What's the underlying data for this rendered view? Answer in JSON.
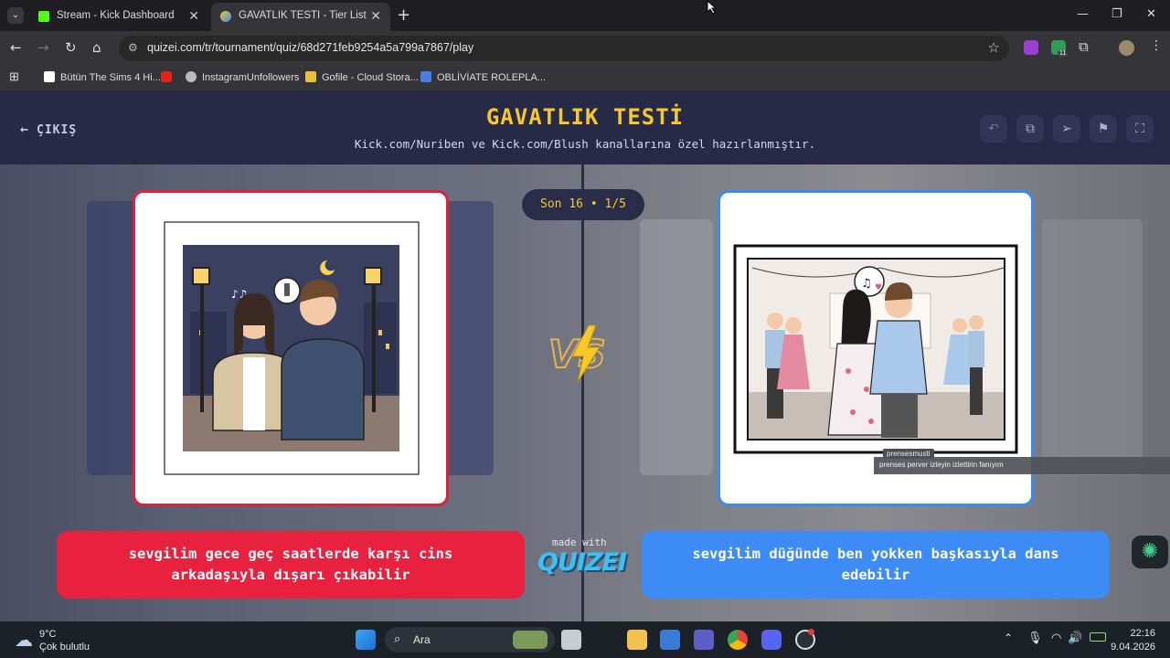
{
  "browser": {
    "tabs": [
      {
        "title": "Stream - Kick Dashboard",
        "active": false
      },
      {
        "title": "GAVATLIK TESTİ - Tier List, Kör S",
        "active": true
      }
    ],
    "url": "quizei.com/tr/tournament/quiz/68d271feb9254a5a799a7867/play",
    "bookmarks": [
      "Bütün The Sims 4 Hi...",
      "",
      "InstagramUnfollowers",
      "Gofile - Cloud Stora...",
      "OBLİVİATE ROLEPLA..."
    ],
    "extension_badge": "11"
  },
  "page": {
    "exit_label": "ÇIKIŞ",
    "title": "GAVATLIK TESTİ",
    "subtitle": "Kick.com/Nuriben ve Kick.com/Blush kanallarına özel hazırlanmıştır.",
    "round_label": "Son 16 • 1/5",
    "vs_label": "VS",
    "left_option": "sevgilim gece geç saatlerde karşı cins arkadaşıyla dışarı çıkabilir",
    "right_option": "sevgilim düğünde ben yokken başkasıyla dans edebilir",
    "made_with": "made with",
    "brand": "QUIZEI",
    "colors": {
      "accent_yellow": "#f7c82a",
      "left_red": "#e8213f",
      "right_blue": "#3d8bf5",
      "header_bg": "#272a47"
    }
  },
  "overlay": {
    "chat_user": "prensesmusti",
    "chat_message": "prenses perver izleyin izlettirin fanıyım"
  },
  "taskbar": {
    "weather_temp": "9°C",
    "weather_desc": "Çok bulutlu",
    "search_label": "Ara",
    "time": "22:16",
    "date": "9.04.2026"
  }
}
